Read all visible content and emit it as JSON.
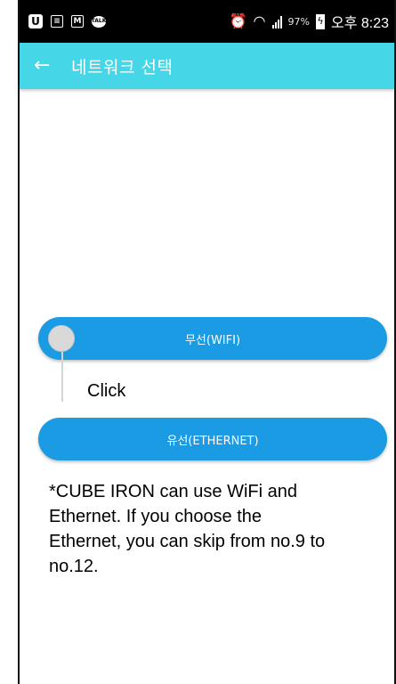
{
  "status_bar": {
    "battery_percent": "97%",
    "time": "오후 8:23"
  },
  "app_bar": {
    "title": "네트워크 선택"
  },
  "buttons": {
    "wifi_label": "무선(WIFI)",
    "ethernet_label": "유선(ETHERNET)"
  },
  "annotation": {
    "click_label": "Click",
    "note": "*CUBE IRON can use WiFi and Ethernet. If you choose the Ethernet, you can skip from no.9 to no.12."
  }
}
